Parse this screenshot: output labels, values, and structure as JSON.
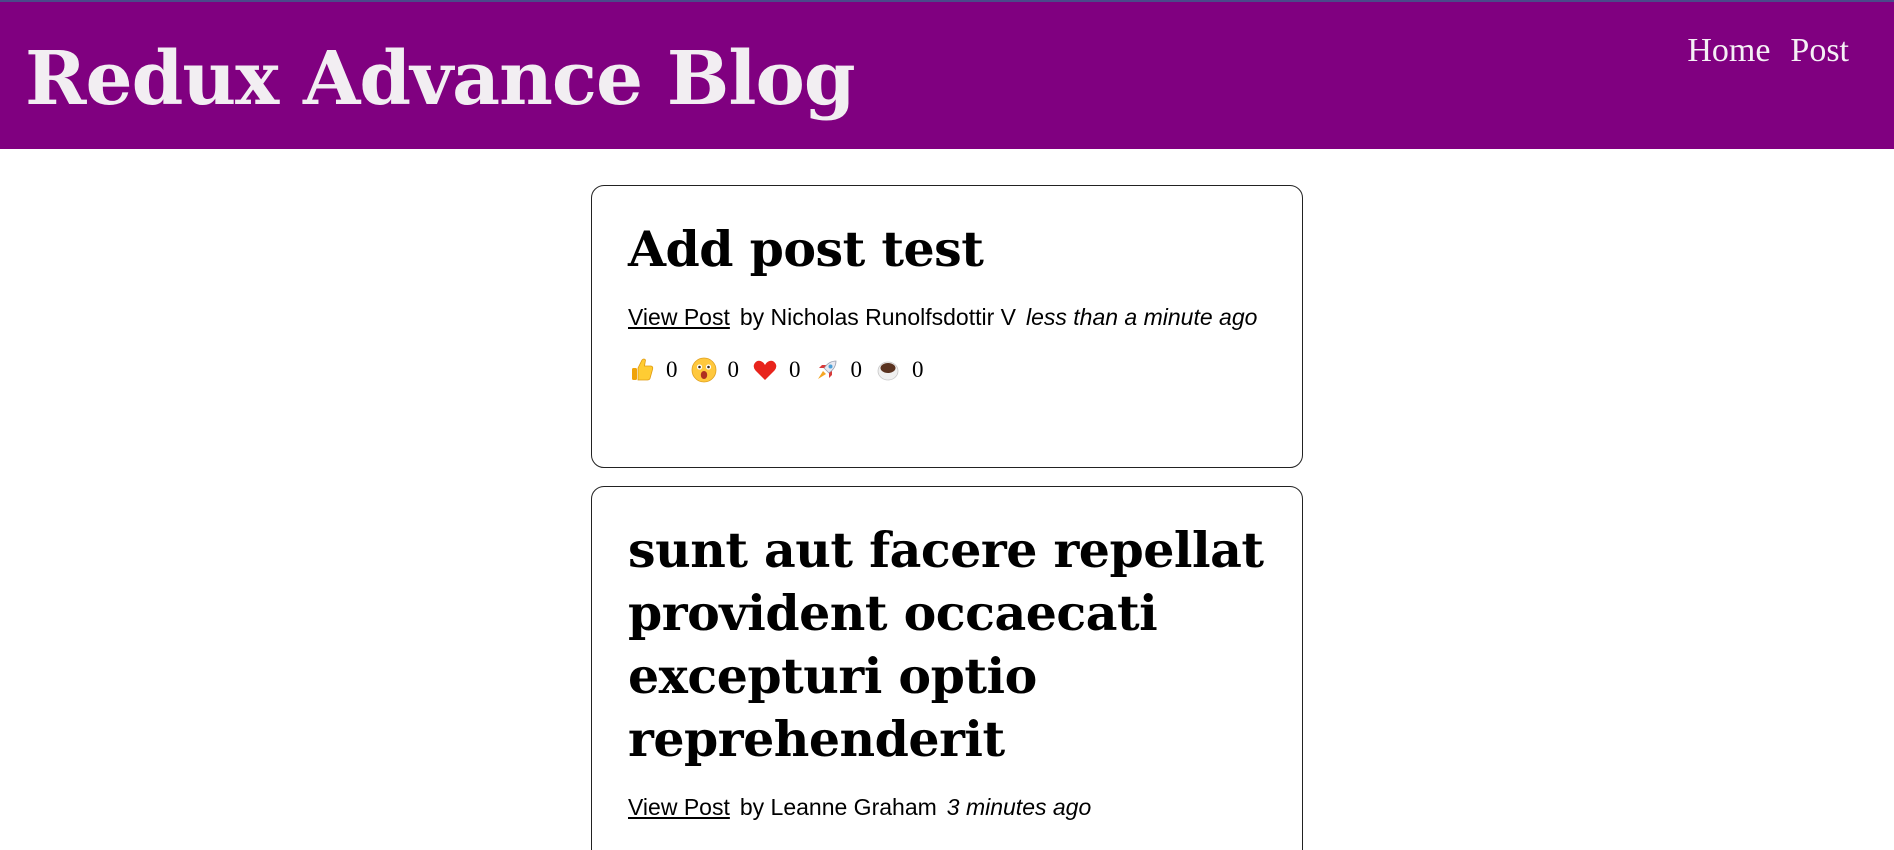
{
  "site": {
    "title": "Redux Advance Blog"
  },
  "nav": {
    "home_label": "Home",
    "post_label": "Post"
  },
  "posts": [
    {
      "title": "Add post test",
      "view_label": "View Post",
      "author": "by Nicholas Runolfsdottir V",
      "time": "less than a minute ago",
      "reactions": [
        {
          "icon": "thumbs-up-icon",
          "count": "0"
        },
        {
          "icon": "wow-face-icon",
          "count": "0"
        },
        {
          "icon": "heart-icon",
          "count": "0"
        },
        {
          "icon": "rocket-icon",
          "count": "0"
        },
        {
          "icon": "coffee-icon",
          "count": "0"
        }
      ]
    },
    {
      "title": "sunt aut facere repellat provident occaecati excepturi optio reprehenderit",
      "view_label": "View Post",
      "author": "by Leanne Graham",
      "time": "3 minutes ago"
    }
  ],
  "colors": {
    "header_bg": "#800080",
    "header_text": "#f2eef2",
    "card_border": "#222222"
  }
}
